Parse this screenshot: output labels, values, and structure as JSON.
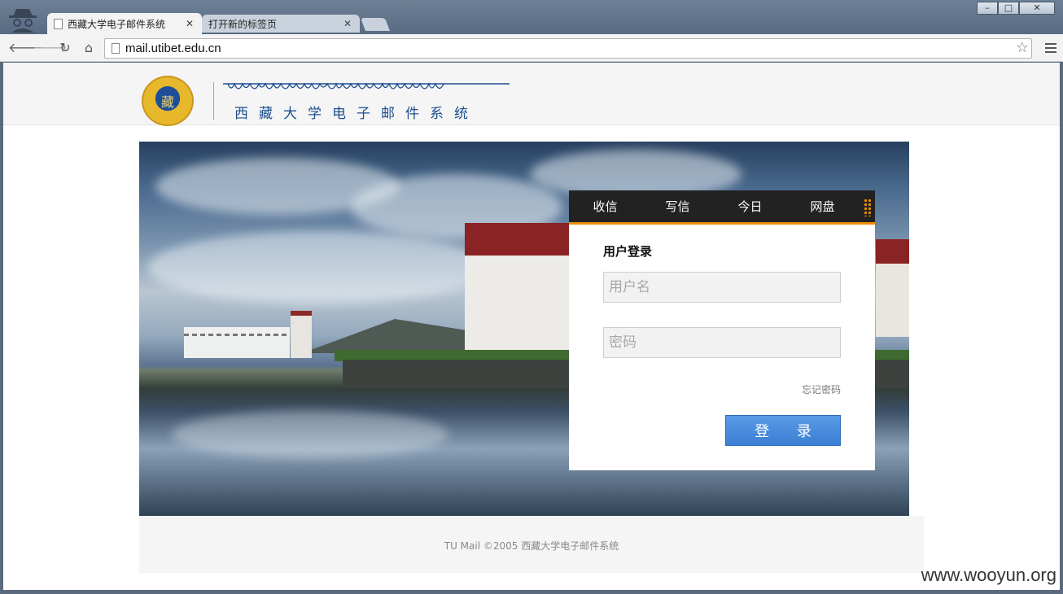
{
  "browser": {
    "tabs": [
      {
        "title": "西藏大学电子邮件系统",
        "active": true
      },
      {
        "title": "打开新的标签页",
        "active": false
      }
    ],
    "url": "mail.utibet.edu.cn",
    "window_buttons": [
      "–",
      "□",
      "✕"
    ]
  },
  "site": {
    "logo_text": "藏",
    "title": "西藏大学电子邮件系统"
  },
  "login": {
    "nav": [
      "收信",
      "写信",
      "今日",
      "网盘"
    ],
    "heading": "用户登录",
    "username_placeholder": "用户名",
    "password_placeholder": "密码",
    "forgot": "忘记密码",
    "submit": "登 录"
  },
  "footer": {
    "text": "TU Mail ©2005 西藏大学电子邮件系统"
  },
  "watermark": "www.wooyun.org",
  "colors": {
    "accent": "#f08c00",
    "button": "#4a8de0",
    "title_blue": "#1d4f8f"
  }
}
